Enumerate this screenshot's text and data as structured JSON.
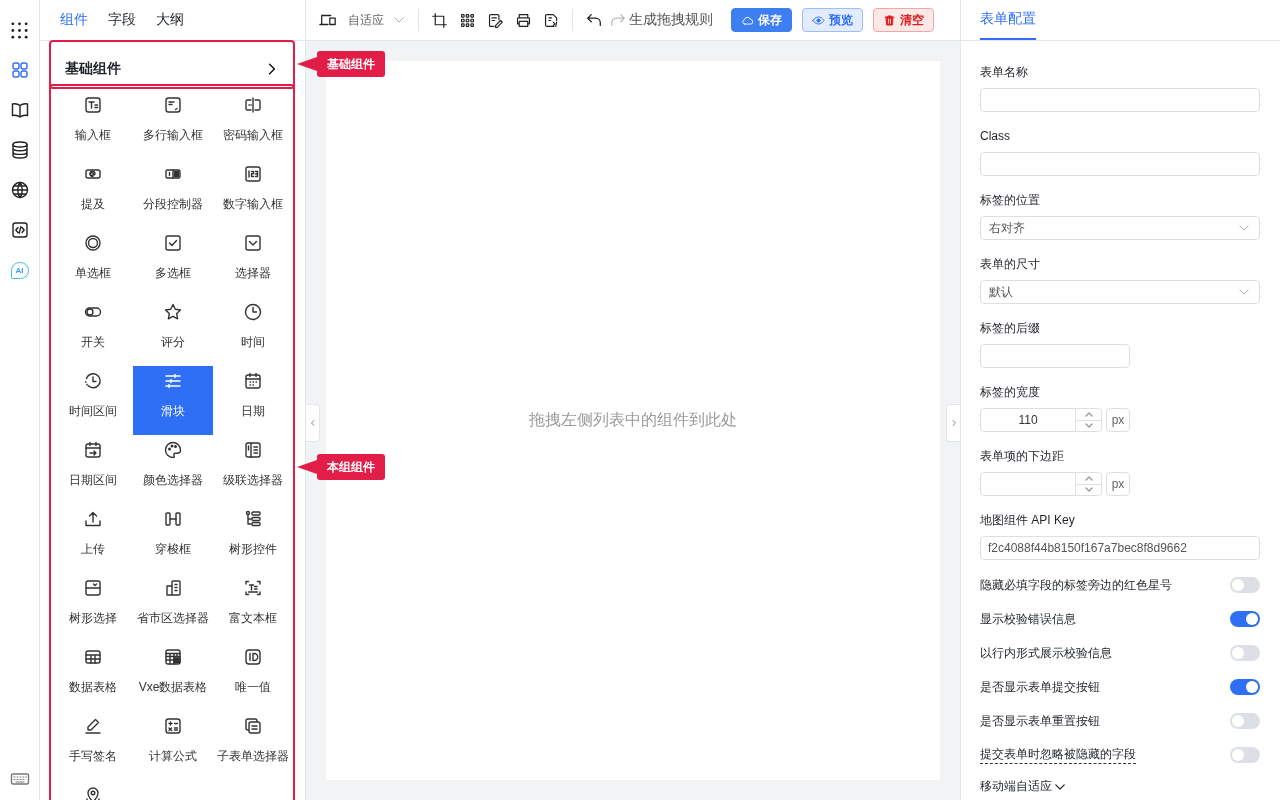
{
  "rail": {
    "items": [
      {
        "selected": true
      },
      {
        "selected": false
      },
      {
        "selected": false
      },
      {
        "selected": false
      },
      {
        "selected": false
      },
      {
        "label": "AI",
        "selected": false
      }
    ]
  },
  "panel_tabs": [
    {
      "label": "组件",
      "selected": true
    },
    {
      "label": "字段",
      "selected": false
    },
    {
      "label": "大纲",
      "selected": false
    }
  ],
  "group": {
    "title": "基础组件",
    "items": [
      {
        "label": "输入框",
        "selected": false
      },
      {
        "label": "多行输入框",
        "selected": false
      },
      {
        "label": "密码输入框",
        "selected": false
      },
      {
        "label": "提及",
        "selected": false
      },
      {
        "label": "分段控制器",
        "selected": false
      },
      {
        "label": "数字输入框",
        "selected": false
      },
      {
        "label": "单选框",
        "selected": false
      },
      {
        "label": "多选框",
        "selected": false
      },
      {
        "label": "选择器",
        "selected": false
      },
      {
        "label": "开关",
        "selected": false
      },
      {
        "label": "评分",
        "selected": false
      },
      {
        "label": "时间",
        "selected": false
      },
      {
        "label": "时间区间",
        "selected": false
      },
      {
        "label": "滑块",
        "selected": true
      },
      {
        "label": "日期",
        "selected": false
      },
      {
        "label": "日期区间",
        "selected": false
      },
      {
        "label": "颜色选择器",
        "selected": false
      },
      {
        "label": "级联选择器",
        "selected": false
      },
      {
        "label": "上传",
        "selected": false
      },
      {
        "label": "穿梭框",
        "selected": false
      },
      {
        "label": "树形控件",
        "selected": false
      },
      {
        "label": "树形选择",
        "selected": false
      },
      {
        "label": "省市区选择器",
        "selected": false
      },
      {
        "label": "富文本框",
        "selected": false
      },
      {
        "label": "数据表格",
        "selected": false
      },
      {
        "label": "Vxe数据表格",
        "selected": false
      },
      {
        "label": "唯一值",
        "selected": false
      },
      {
        "label": "手写签名",
        "selected": false
      },
      {
        "label": "计算公式",
        "selected": false
      },
      {
        "label": "子表单选择器",
        "selected": false
      },
      {
        "selected": false
      }
    ]
  },
  "annotations": [
    {
      "kind": "group_header",
      "text": "基础组件"
    },
    {
      "kind": "group_items",
      "text": "本组组件"
    }
  ],
  "toolbar": {
    "device": "自适应",
    "history": [
      {
        "kind": "undo",
        "disabled": false
      },
      {
        "kind": "redo",
        "disabled": true
      }
    ],
    "generate": "生成拖拽规则",
    "buttons": [
      {
        "kind": "primary",
        "label": "保存"
      },
      {
        "kind": "secondary",
        "label": "预览"
      },
      {
        "kind": "danger",
        "label": "清空"
      }
    ]
  },
  "canvas": {
    "placeholder": "拖拽左侧列表中的组件到此处"
  },
  "config": {
    "tabs": [
      {
        "label": "表单配置",
        "selected": true
      }
    ],
    "fields": [
      {
        "kind": "text",
        "label": "表单名称"
      },
      {
        "kind": "text",
        "label": "Class"
      },
      {
        "kind": "select",
        "label": "标签的位置",
        "value": "右对齐"
      },
      {
        "kind": "select",
        "label": "表单的尺寸",
        "value": "默认"
      },
      {
        "kind": "short",
        "label": "标签的后缀"
      },
      {
        "kind": "number",
        "label": "标签的宽度",
        "value": "110",
        "unit": "px"
      },
      {
        "kind": "number",
        "label": "表单项的下边距",
        "unit": "px"
      },
      {
        "kind": "text",
        "label": "地图组件 API Key",
        "value": "f2c4088f44b8150f167a7bec8f8d9662"
      },
      {
        "kind": "switch",
        "label": "隐藏必填字段的标签旁边的红色星号",
        "on": false,
        "hint": false
      },
      {
        "kind": "switch",
        "label": "显示校验错误信息",
        "on": true,
        "hint": false
      },
      {
        "kind": "switch",
        "label": "以行内形式展示校验信息",
        "on": false,
        "hint": false
      },
      {
        "kind": "switch",
        "label": "是否显示表单提交按钮",
        "on": true,
        "hint": false
      },
      {
        "kind": "switch",
        "label": "是否显示表单重置按钮",
        "on": false,
        "hint": false
      },
      {
        "kind": "switch",
        "label": "提交表单时忽略被隐藏的字段",
        "on": false,
        "hint": true
      }
    ],
    "footer": "移动端自适应"
  }
}
